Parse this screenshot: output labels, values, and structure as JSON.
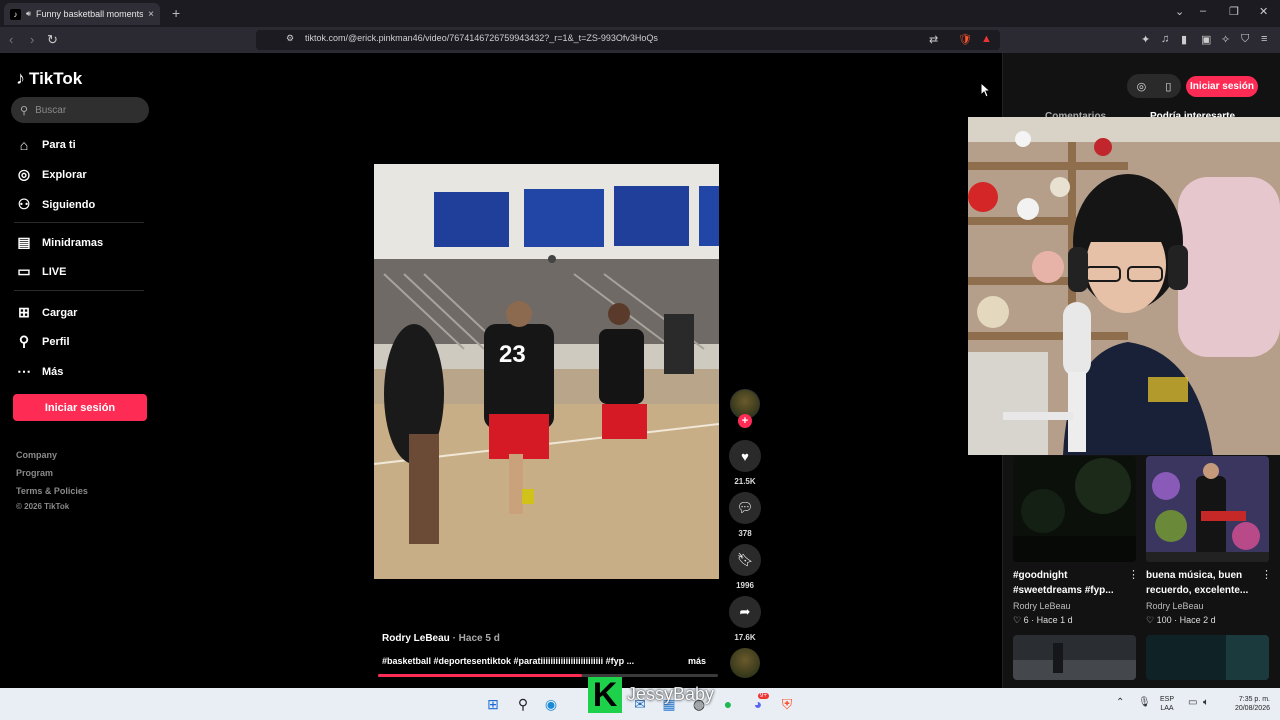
{
  "browser": {
    "tab_title": "Funny basketball moments c",
    "tab_close": "×",
    "new_tab": "+",
    "url": "tiktok.com/@erick.pinkman46/video/7674146726759943432?_r=1&_t=ZS-993Ofv3HoQs",
    "window_controls": [
      "⌄",
      "–",
      "❐",
      "✕"
    ]
  },
  "sidebar": {
    "logo": "TikTok",
    "search_placeholder": "Buscar",
    "items": [
      {
        "label": "Para ti",
        "icon": "home-icon"
      },
      {
        "label": "Explorar",
        "icon": "compass-icon"
      },
      {
        "label": "Siguiendo",
        "icon": "following-icon"
      },
      {
        "label": "Minidramas",
        "icon": "minidramas-icon"
      },
      {
        "label": "LIVE",
        "icon": "live-icon"
      },
      {
        "label": "Cargar",
        "icon": "upload-icon"
      },
      {
        "label": "Perfil",
        "icon": "profile-icon"
      },
      {
        "label": "Más",
        "icon": "more-icon"
      }
    ],
    "login_button": "Iniciar sesión",
    "footer_links": [
      "Company",
      "Program",
      "Terms & Policies"
    ],
    "copyright": "© 2026 TikTok"
  },
  "video": {
    "author": "Rodry LeBeau",
    "posted": " · Hace 5 d",
    "caption": "#basketball #deportesentiktok #paratiiiiiiiiiiiiiiiiiiiiiiiii #fyp ...",
    "more": "más",
    "jersey_number": "23",
    "progress": 0.6,
    "likes": "21.5K",
    "comments": "378",
    "saves": "1996",
    "shares": "17.6K"
  },
  "right_panel": {
    "login_button": "Iniciar sesión",
    "tabs": [
      "Comentarios",
      "Podría interesarte"
    ],
    "cards": [
      {
        "title": "#goodnight #sweetdreams #fyp...",
        "author": "Rodry LeBeau",
        "likes": "6",
        "time": "Hace 1 d"
      },
      {
        "title": "buena música, buen recuerdo, excelente...",
        "author": "Rodry LeBeau",
        "likes": "100",
        "time": "Hace 2 d"
      }
    ]
  },
  "overlay": {
    "logo_letter": "K",
    "streamer_name": "JessyBaby"
  },
  "taskbar": {
    "lang_top": "ESP",
    "lang_bottom": "LAA",
    "time": "7:35 p. m.",
    "date": "20/08/2026",
    "notification_badge": "9+"
  },
  "colors": {
    "accent": "#fe2c55",
    "background": "#000000",
    "panel": "#121212"
  }
}
